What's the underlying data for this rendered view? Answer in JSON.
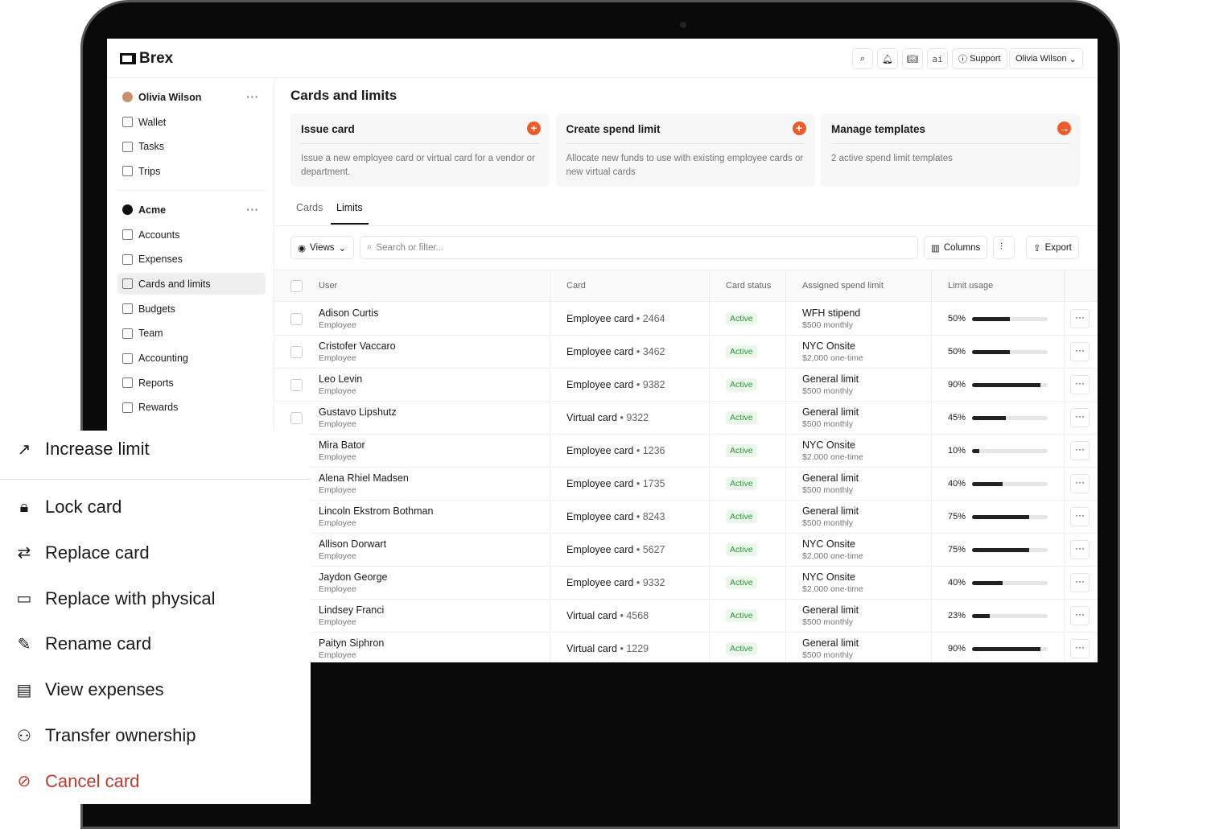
{
  "header": {
    "brand": "Brex",
    "support": "Support",
    "user": "Olivia Wilson",
    "ai": "ai"
  },
  "sidebar": {
    "user": "Olivia Wilson",
    "personal": [
      "Wallet",
      "Tasks",
      "Trips"
    ],
    "company": "Acme",
    "items": [
      "Accounts",
      "Expenses",
      "Cards and limits",
      "Budgets",
      "Team",
      "Accounting",
      "Reports",
      "Rewards"
    ],
    "active": "Cards and limits"
  },
  "page": {
    "title": "Cards and limits"
  },
  "actions": [
    {
      "title": "Issue card",
      "desc": "Issue a new employee card or virtual card for a vendor or department.",
      "icon": "plus-icon"
    },
    {
      "title": "Create spend limit",
      "desc": "Allocate new funds to use with existing employee cards or new virtual cards",
      "icon": "plus-icon"
    },
    {
      "title": "Manage templates",
      "desc": "2 active spend limit templates",
      "icon": "arrow-right-icon"
    }
  ],
  "tabs": [
    "Cards",
    "Limits"
  ],
  "active_tab": "Limits",
  "toolbar": {
    "views": "Views",
    "search_placeholder": "Search or filter...",
    "columns": "Columns",
    "export": "Export"
  },
  "table": {
    "headers": [
      "User",
      "Card",
      "Card status",
      "Assigned spend limit",
      "Limit usage"
    ],
    "rows": [
      {
        "name": "Adison Curtis",
        "role": "Employee",
        "card": "Employee card",
        "last4": "2464",
        "status": "Active",
        "limit": "WFH stipend",
        "amount": "$500 monthly",
        "usage": 50
      },
      {
        "name": "Cristofer Vaccaro",
        "role": "Employee",
        "card": "Employee card",
        "last4": "3462",
        "status": "Active",
        "limit": "NYC Onsite",
        "amount": "$2,000 one-time",
        "usage": 50
      },
      {
        "name": "Leo Levin",
        "role": "Employee",
        "card": "Employee card",
        "last4": "9382",
        "status": "Active",
        "limit": "General limit",
        "amount": "$500 monthly",
        "usage": 90
      },
      {
        "name": "Gustavo Lipshutz",
        "role": "Employee",
        "card": "Virtual card",
        "last4": "9322",
        "status": "Active",
        "limit": "General limit",
        "amount": "$500 monthly",
        "usage": 45
      },
      {
        "name": "Mira Bator",
        "role": "Employee",
        "card": "Employee card",
        "last4": "1236",
        "status": "Active",
        "limit": "NYC Onsite",
        "amount": "$2,000 one-time",
        "usage": 10
      },
      {
        "name": "Alena Rhiel Madsen",
        "role": "Employee",
        "card": "Employee card",
        "last4": "1735",
        "status": "Active",
        "limit": "General limit",
        "amount": "$500 monthly",
        "usage": 40
      },
      {
        "name": "Lincoln Ekstrom Bothman",
        "role": "Employee",
        "card": "Employee card",
        "last4": "8243",
        "status": "Active",
        "limit": "General limit",
        "amount": "$500 monthly",
        "usage": 75
      },
      {
        "name": "Allison Dorwart",
        "role": "Employee",
        "card": "Employee card",
        "last4": "5627",
        "status": "Active",
        "limit": "NYC Onsite",
        "amount": "$2,000 one-time",
        "usage": 75
      },
      {
        "name": "Jaydon George",
        "role": "Employee",
        "card": "Employee card",
        "last4": "9332",
        "status": "Active",
        "limit": "NYC Onsite",
        "amount": "$2,000 one-time",
        "usage": 40
      },
      {
        "name": "Lindsey Franci",
        "role": "Employee",
        "card": "Virtual card",
        "last4": "4568",
        "status": "Active",
        "limit": "General limit",
        "amount": "$500 monthly",
        "usage": 23
      },
      {
        "name": "Paityn Siphron",
        "role": "Employee",
        "card": "Virtual card",
        "last4": "1229",
        "status": "Active",
        "limit": "General limit",
        "amount": "$500 monthly",
        "usage": 90
      }
    ]
  },
  "menu": {
    "items": [
      {
        "label": "Increase limit",
        "icon": "trending-up-icon"
      },
      {
        "label": "Lock card",
        "icon": "lock-icon"
      },
      {
        "label": "Replace card",
        "icon": "repeat-icon"
      },
      {
        "label": "Replace with physical",
        "icon": "card-icon"
      },
      {
        "label": "Rename card",
        "icon": "pencil-icon"
      },
      {
        "label": "View expenses",
        "icon": "document-icon"
      },
      {
        "label": "Transfer ownership",
        "icon": "user-transfer-icon"
      },
      {
        "label": "Cancel card",
        "icon": "card-off-icon",
        "danger": true
      }
    ],
    "danger_color": "#c0392b"
  },
  "colors": {
    "accent": "#f05a28",
    "active": "#2e9a3a"
  }
}
